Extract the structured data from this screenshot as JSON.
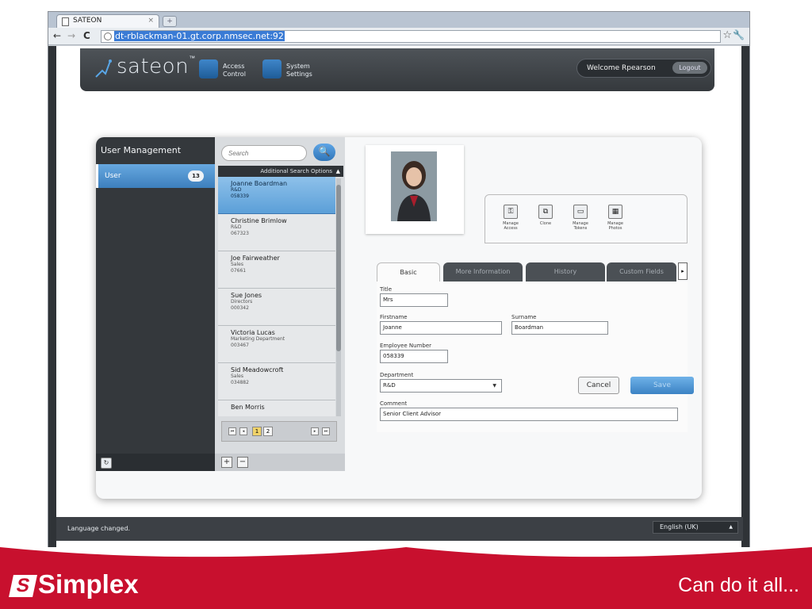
{
  "browser": {
    "tab_title": "SATEON",
    "tab_close": "×",
    "new_tab": "+",
    "back": "←",
    "forward": "→",
    "reload": "C",
    "url": "dt-rblackman-01.gt.corp.nmsec.net:92",
    "star": "☆",
    "wrench": "🔧"
  },
  "header": {
    "logo": "sateon",
    "logo_tm": "™",
    "nav": [
      {
        "line1": "Access",
        "line2": "Control"
      },
      {
        "line1": "System",
        "line2": "Settings"
      }
    ],
    "welcome": "Welcome Rpearson",
    "logout": "Logout"
  },
  "sidebar": {
    "title": "User Management",
    "item_label": "User",
    "item_count": "13",
    "refresh": "↻"
  },
  "search": {
    "placeholder": "Search",
    "button_icon": "🔍",
    "additional": "Additional Search Options",
    "caret": "▲"
  },
  "users": [
    {
      "name": "Joanne Boardman",
      "dept": "R&D",
      "number": "058339"
    },
    {
      "name": "Christine Brimlow",
      "dept": "R&D",
      "number": "067323"
    },
    {
      "name": "Joe Fairweather",
      "dept": "Sales",
      "number": "07661"
    },
    {
      "name": "Sue Jones",
      "dept": "Directors",
      "number": "000342"
    },
    {
      "name": "Victoria Lucas",
      "dept": "Marketing Department",
      "number": "003467"
    },
    {
      "name": "Sid Meadowcroft",
      "dept": "Sales",
      "number": "034882"
    },
    {
      "name": "Ben Morris",
      "dept": "",
      "number": ""
    }
  ],
  "pager": {
    "first": "⏮",
    "prev": "◂",
    "page1": "1",
    "page2": "2",
    "next": "▸",
    "last": "⏭"
  },
  "list_actions": {
    "add": "+",
    "remove": "−"
  },
  "actions": [
    {
      "label1": "Manage",
      "label2": "Access",
      "icon": "⚿"
    },
    {
      "label1": "Clone",
      "label2": "",
      "icon": "⧉"
    },
    {
      "label1": "Manage",
      "label2": "Tokens",
      "icon": "▭"
    },
    {
      "label1": "Manage",
      "label2": "Photos",
      "icon": "▦"
    }
  ],
  "tabs": [
    "Basic",
    "More Information",
    "History",
    "Custom Fields"
  ],
  "tab_arrow": "▸",
  "form": {
    "title_label": "Title",
    "title_value": "Mrs",
    "firstname_label": "Firstname",
    "firstname_value": "Joanne",
    "surname_label": "Surname",
    "surname_value": "Boardman",
    "employee_label": "Employee Number",
    "employee_value": "058339",
    "department_label": "Department",
    "department_value": "R&D",
    "department_caret": "▼",
    "comment_label": "Comment",
    "comment_value": "Senior Client Advisor"
  },
  "buttons": {
    "cancel": "Cancel",
    "save": "Save"
  },
  "status": {
    "message": "Language changed.",
    "language": "English (UK)",
    "caret": "▲"
  },
  "slide": {
    "brand": "Simplex",
    "brand_mark": "S",
    "tagline": "Can do it all..."
  },
  "colors": {
    "accent": "#3d7fbd",
    "brand_red": "#c8102e",
    "dark": "#34383c"
  }
}
